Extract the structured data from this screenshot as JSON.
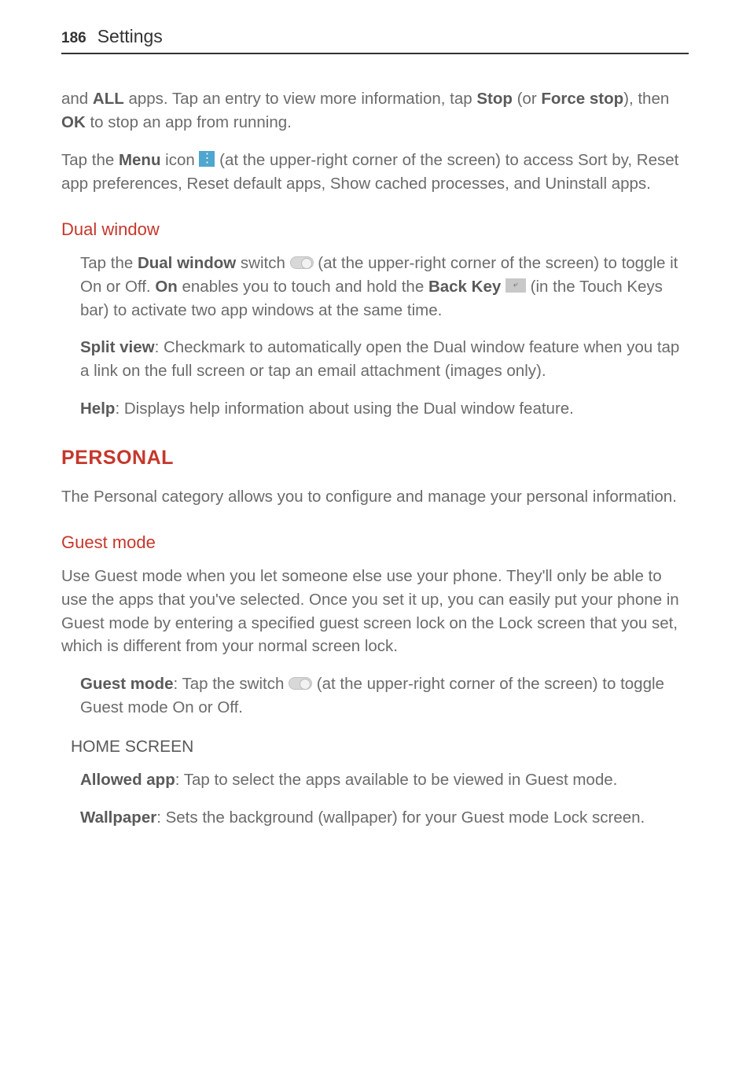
{
  "header": {
    "pageNumber": "186",
    "title": "Settings"
  },
  "intro": {
    "p1_a": "and ",
    "p1_b": "ALL",
    "p1_c": " apps. Tap an entry to view more information, tap ",
    "p1_d": "Stop",
    "p1_e": " (or ",
    "p1_f": "Force stop",
    "p1_g": "), then ",
    "p1_h": "OK",
    "p1_i": " to stop an app from running.",
    "p2_a": "Tap the ",
    "p2_b": "Menu",
    "p2_c": " icon ",
    "p2_d": " (at the upper-right corner of the screen) to access Sort by, Reset app preferences, Reset default apps, Show cached processes, and Uninstall apps."
  },
  "dualWindow": {
    "heading": "Dual window",
    "p1_a": "Tap the ",
    "p1_b": "Dual window",
    "p1_c": " switch ",
    "p1_d": " (at the upper-right corner of the screen) to toggle it On or Off. ",
    "p1_e": "On",
    "p1_f": " enables you to touch and hold the ",
    "p1_g": "Back Key",
    "p1_h": " ",
    "p1_i": " (in the Touch Keys bar) to activate two app windows at the same time.",
    "p2_a": "Split view",
    "p2_b": ": Checkmark to automatically open the Dual window feature when you tap a link on the full screen or tap an email attachment (images only).",
    "p3_a": "Help",
    "p3_b": ": Displays help information about using the Dual window feature."
  },
  "personal": {
    "heading": "PERSONAL",
    "intro": "The Personal category allows you to configure and manage your personal information."
  },
  "guestMode": {
    "heading": "Guest mode",
    "intro": "Use Guest mode when you let someone else use your phone. They'll only be able to use the apps that you've selected. Once you set it up, you can easily put your phone in Guest mode by entering a specified guest screen lock on the Lock screen that you set, which is different from your normal screen lock.",
    "p1_a": "Guest mode",
    "p1_b": ": Tap the switch ",
    "p1_c": " (at the upper-right corner of the screen) to toggle Guest mode On or Off.",
    "homeScreenHead": "HOME SCREEN",
    "p2_a": "Allowed app",
    "p2_b": ": Tap to select the apps available to be viewed in Guest mode.",
    "p3_a": "Wallpaper",
    "p3_b": ": Sets the background (wallpaper) for your Guest mode Lock screen."
  }
}
